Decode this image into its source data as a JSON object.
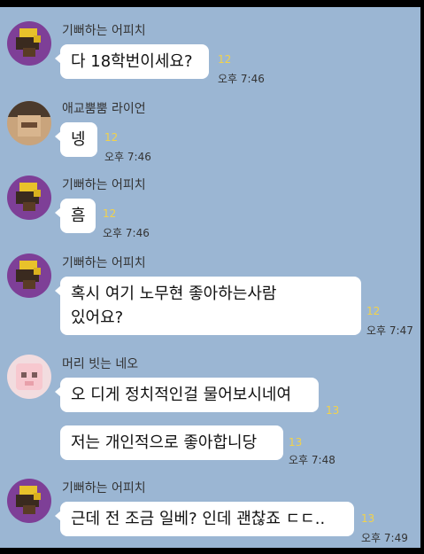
{
  "colors": {
    "background": "#9bb6d3",
    "bubble": "#ffffff",
    "unread": "#f2d24a"
  },
  "messages": [
    {
      "sender": "기뻐하는 어피치",
      "avatar": "purple",
      "text": "다 18학번이세요?",
      "unread": "12",
      "time": "오후 7:46"
    },
    {
      "sender": "애교뿜뿜 라이언",
      "avatar": "brown",
      "text": "넹",
      "unread": "12",
      "time": "오후 7:46"
    },
    {
      "sender": "기뻐하는 어피치",
      "avatar": "purple",
      "text": "흠",
      "unread": "12",
      "time": "오후 7:46"
    },
    {
      "sender": "기뻐하는 어피치",
      "avatar": "purple",
      "text_line1": "혹시 여기 노무현 좋아하는사람",
      "text_line2": "있어요?",
      "unread": "12",
      "time": "오후 7:47"
    },
    {
      "sender": "머리 빗는 네오",
      "avatar": "pink",
      "text": "오 디게 정치적인걸 물어보시네여",
      "unread": "13"
    },
    {
      "text": "저는 개인적으로 좋아합니당",
      "unread": "13",
      "time": "오후 7:48"
    },
    {
      "sender": "기뻐하는 어피치",
      "avatar": "purple",
      "text": "근데 전 조금 일베? 인데 괜찮죠 ㄷㄷ..",
      "unread": "13",
      "time": "오후 7:49"
    }
  ]
}
